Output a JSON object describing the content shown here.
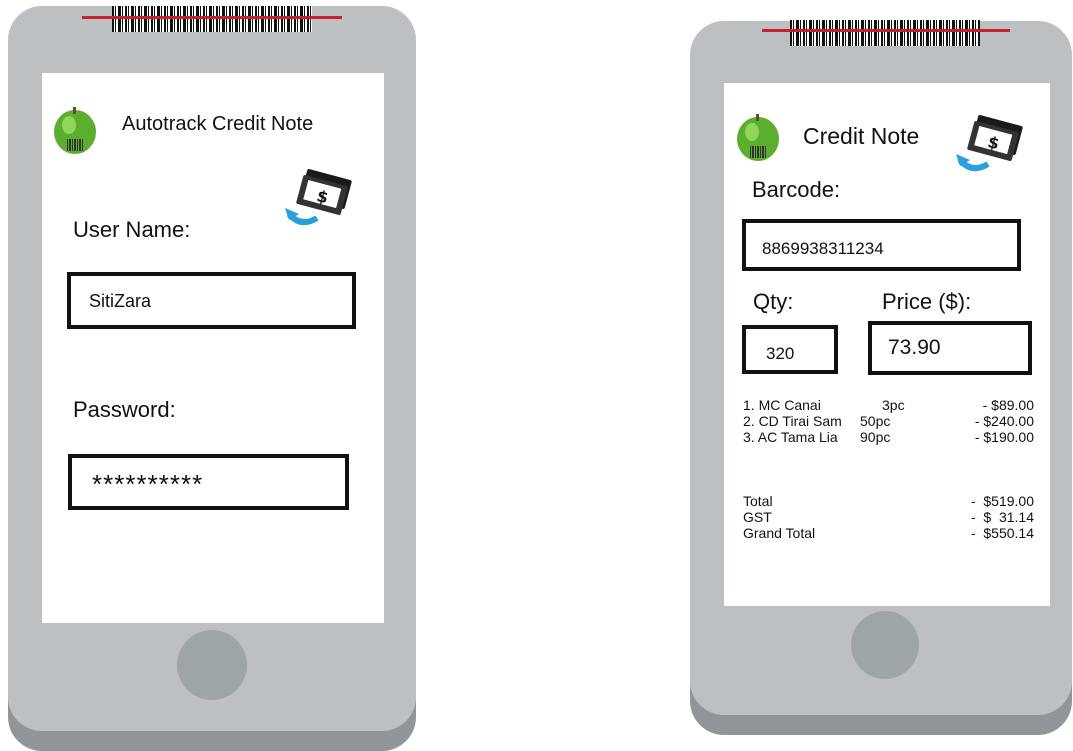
{
  "login_screen": {
    "app_title": "Autotrack Credit Note",
    "username_label": "User Name:",
    "username_value": "SitiZara",
    "password_label": "Password:",
    "password_value": "**********"
  },
  "credit_note_screen": {
    "title": "Credit Note",
    "barcode_label": "Barcode:",
    "barcode_value": "8869938311234",
    "qty_label": "Qty:",
    "qty_value": "320",
    "price_label": "Price ($):",
    "price_value": "73.90",
    "items": [
      {
        "name": "1. MC Canai",
        "qty": "3pc",
        "amount": "- $89.00"
      },
      {
        "name": "2. CD Tirai Sam",
        "qty": "50pc",
        "amount": "- $240.00"
      },
      {
        "name": "3. AC Tama Lia",
        "qty": "90pc",
        "amount": "- $190.00"
      }
    ],
    "totals": [
      {
        "label": "Total",
        "amount": "-  $519.00"
      },
      {
        "label": "GST",
        "amount": "-  $  31.14"
      },
      {
        "label": "Grand Total",
        "amount": "-  $550.14"
      }
    ]
  },
  "icons": {
    "app_icon": "green-apple-barcode-icon",
    "money_icon": "money-refund-icon"
  },
  "colors": {
    "phone_body": "#bcc0c3",
    "laser": "#c8202a",
    "refund_arrow": "#2a9ee0"
  }
}
